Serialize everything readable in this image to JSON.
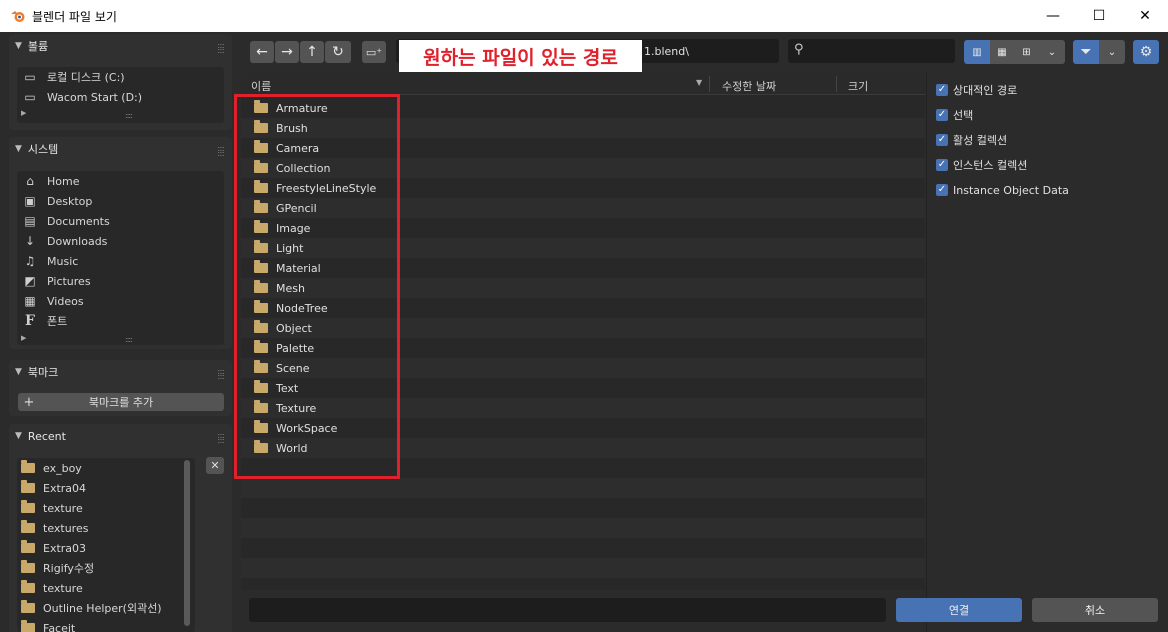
{
  "window": {
    "title": "블렌더 파일 보기",
    "minimize": "—",
    "maximize": "☐",
    "close": "✕"
  },
  "sidebar": {
    "volumes": {
      "title": "볼륨",
      "items": [
        {
          "label": "로컬 디스크 (C:)",
          "icon": "drive-icon"
        },
        {
          "label": "Wacom Start (D:)",
          "icon": "drive-icon"
        }
      ]
    },
    "system": {
      "title": "시스템",
      "items": [
        {
          "label": "Home",
          "icon": "home-icon"
        },
        {
          "label": "Desktop",
          "icon": "desktop-icon"
        },
        {
          "label": "Documents",
          "icon": "documents-icon"
        },
        {
          "label": "Downloads",
          "icon": "download-icon"
        },
        {
          "label": "Music",
          "icon": "music-icon"
        },
        {
          "label": "Pictures",
          "icon": "pictures-icon"
        },
        {
          "label": "Videos",
          "icon": "videos-icon"
        },
        {
          "label": "폰트",
          "icon": "font-icon"
        }
      ]
    },
    "bookmarks": {
      "title": "북마크",
      "add_label": "북마크를 추가"
    },
    "recent": {
      "title": "Recent",
      "items": [
        "ex_boy",
        "Extra04",
        "texture",
        "textures",
        "Extra03",
        "Rigify수정",
        "texture",
        "Outline Helper(외곽선)",
        "Faceit"
      ]
    }
  },
  "toolbar": {
    "path_suffix": "1.blend\\",
    "annotation": "원하는 파일이 있는 경로",
    "search_placeholder": ""
  },
  "filelist": {
    "columns": {
      "name": "이름",
      "date": "수정한 날짜",
      "size": "크기"
    },
    "items": [
      "Armature",
      "Brush",
      "Camera",
      "Collection",
      "FreestyleLineStyle",
      "GPencil",
      "Image",
      "Light",
      "Material",
      "Mesh",
      "NodeTree",
      "Object",
      "Palette",
      "Scene",
      "Text",
      "Texture",
      "WorkSpace",
      "World"
    ]
  },
  "options": [
    "상대적인 경로",
    "선택",
    "활성 컬렉션",
    "인스턴스 컬렉션",
    "Instance Object Data"
  ],
  "footer": {
    "filename_value": "",
    "confirm_label": "연결",
    "cancel_label": "취소"
  },
  "colors": {
    "accent": "#4772b3",
    "highlight_box": "#e0202a",
    "folder": "#c8a96a"
  }
}
